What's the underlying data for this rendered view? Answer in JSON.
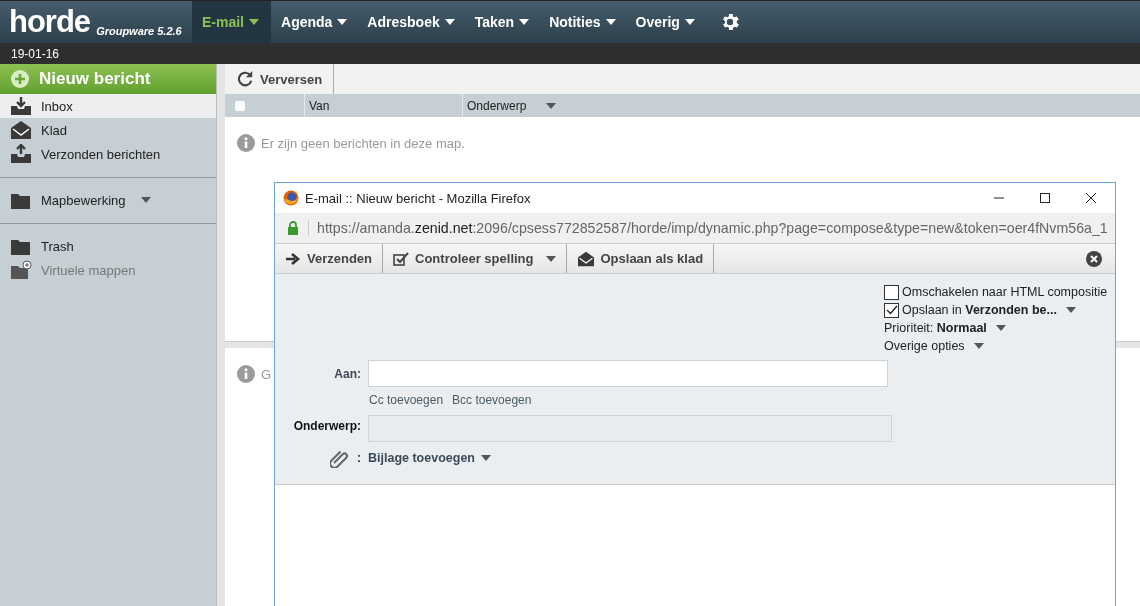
{
  "app": {
    "logo": "horde",
    "version": "Groupware 5.2.6"
  },
  "nav": [
    {
      "label": "E-mail",
      "selected": true
    },
    {
      "label": "Agenda",
      "selected": false
    },
    {
      "label": "Adresboek",
      "selected": false
    },
    {
      "label": "Taken",
      "selected": false
    },
    {
      "label": "Notities",
      "selected": false
    },
    {
      "label": "Overig",
      "selected": false
    }
  ],
  "date": "19-01-16",
  "sidebar": {
    "new_message": "Nieuw bericht",
    "groups": [
      [
        {
          "label": "Inbox",
          "kind": "inbox",
          "selected": true,
          "disabled": false
        },
        {
          "label": "Klad",
          "kind": "drafts",
          "selected": false,
          "disabled": false
        },
        {
          "label": "Verzonden berichten",
          "kind": "sent",
          "selected": false,
          "disabled": false
        }
      ],
      [
        {
          "label": "Mapbewerking",
          "kind": "menu",
          "selected": false,
          "disabled": false
        }
      ],
      [
        {
          "label": "Trash",
          "kind": "folder",
          "selected": false,
          "disabled": false
        },
        {
          "label": "Virtuele mappen",
          "kind": "virtual",
          "selected": false,
          "disabled": true
        }
      ]
    ]
  },
  "toolbar": {
    "refresh": "Verversen"
  },
  "table": {
    "select_all": {
      "checked": false
    },
    "columns": [
      {
        "label": "Van",
        "sortable": false
      },
      {
        "label": "Onderwerp",
        "sortable": true
      }
    ],
    "empty": "Er zijn geen berichten in deze map."
  },
  "preview": {
    "message": "G"
  },
  "popup": {
    "title": "E-mail :: Nieuw bericht - Mozilla Firefox",
    "url": {
      "prefix": "https://amanda.",
      "domain": "zenid.net",
      "suffix": ":2096/cpsess772852587/horde/imp/dynamic.php?page=compose&type=new&token=oer4fNvm56a_1"
    },
    "toolbar": [
      {
        "label": "Verzenden",
        "kind": "send",
        "dropdown": false
      },
      {
        "label": "Controleer spelling",
        "kind": "spell",
        "dropdown": true
      },
      {
        "label": "Opslaan als klad",
        "kind": "draft",
        "dropdown": false
      }
    ],
    "options": [
      {
        "kind": "checkbox",
        "text": "Omschakelen naar HTML compositie",
        "checked": false,
        "dropdown": false
      },
      {
        "kind": "checkbox",
        "text": "Opslaan in **Verzonden be...**",
        "checked": true,
        "dropdown": true
      },
      {
        "kind": "text",
        "text": "Prioriteit: **Normaal**",
        "dropdown": true
      },
      {
        "kind": "text",
        "text": "Overige opties",
        "dropdown": true
      }
    ],
    "to": {
      "label": "Aan:"
    },
    "cc_links": [
      "Cc toevoegen",
      "Bcc toevoegen"
    ],
    "subject": {
      "label": "Onderwerp:"
    },
    "attachment": {
      "label": ":",
      "link": "Bijlage toevoegen"
    }
  }
}
